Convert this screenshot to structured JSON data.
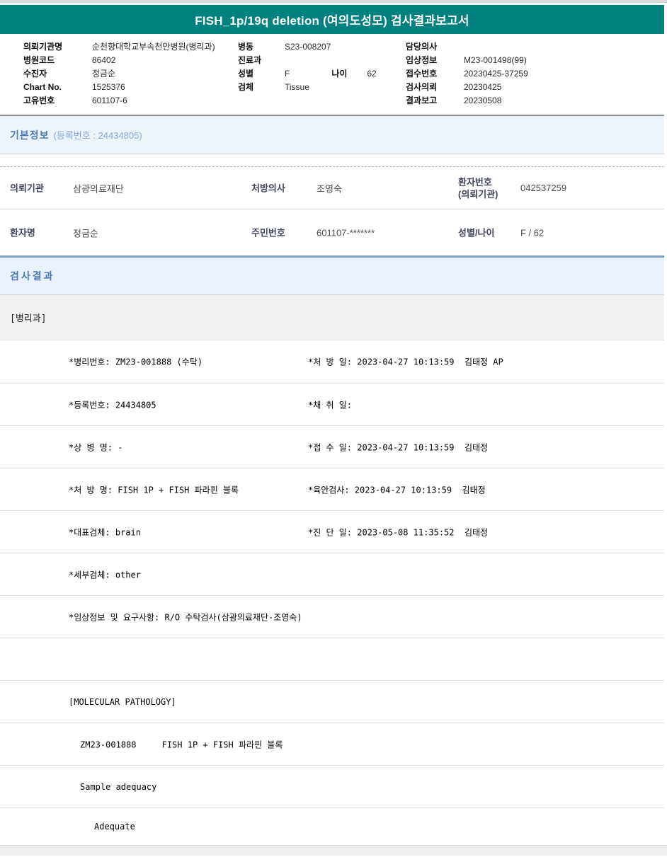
{
  "title": "FISH_1p/19q deletion (여의도성모) 검사결과보고서",
  "colors": {
    "header_teal": "#00807e",
    "section_title_blue": "#4a7ab5",
    "section_band_blue": "#edf3fa",
    "divider_steel_blue": "#7d9fc1"
  },
  "patient_header": {
    "col1": [
      {
        "label": "의뢰기관명",
        "value": "순천향대학교부속천안병원(병리과)"
      },
      {
        "label": "병원코드",
        "value": "86402"
      },
      {
        "label": "수진자",
        "value": "정금순"
      },
      {
        "label": "Chart No.",
        "value": "1525376"
      },
      {
        "label": "고유번호",
        "value": "601107-6"
      }
    ],
    "col2": [
      {
        "label": "병동",
        "value": "S23-008207"
      },
      {
        "label": "진료과",
        "value": ""
      },
      {
        "label": "성별",
        "value": "F",
        "label2": "나이",
        "value2": "62"
      },
      {
        "label": "검체",
        "value": "Tissue"
      }
    ],
    "col3": [
      {
        "label": "담당의사",
        "value": ""
      },
      {
        "label": "임상정보",
        "value": "M23-001498(99)"
      },
      {
        "label": "접수번호",
        "value": "20230425-37259"
      },
      {
        "label": "검사의뢰",
        "value": "20230425"
      },
      {
        "label": "결과보고",
        "value": "20230508"
      }
    ]
  },
  "basic_info": {
    "section_title": "기본정보",
    "section_sub": "(등록번호 : 24434805)",
    "rows": [
      [
        {
          "label_lines": [
            "의뢰기관"
          ],
          "value": "삼광의료재단"
        },
        {
          "label_lines": [
            "처방의사"
          ],
          "value": "조영숙"
        },
        {
          "label_lines": [
            "환자번호",
            "(의뢰기관)"
          ],
          "value": "042537259"
        }
      ],
      [
        {
          "label_lines": [
            "환자명"
          ],
          "value": "정금순"
        },
        {
          "label_lines": [
            "주민번호"
          ],
          "value": "601107-*******"
        },
        {
          "label_lines": [
            "성별/나이"
          ],
          "value": "F / 62"
        }
      ]
    ]
  },
  "results": {
    "section_title": "검사결과",
    "department": "[병리과]",
    "rows": [
      {
        "left": "*병리번호: ZM23-001888 (수탁)",
        "right": "*처 방 일: 2023-04-27 10:13:59  김태정 AP",
        "indent": 0
      },
      {
        "left": "*등록번호: 24434805",
        "right": "*채 취 일:",
        "indent": 0
      },
      {
        "left": "*상 병 명: -",
        "right": "*접 수 일: 2023-04-27 10:13:59  김태정",
        "indent": 0
      },
      {
        "left": "*처 방 명: FISH 1P + FISH 파라핀 블록",
        "right": "*육안검사: 2023-04-27 10:13:59  김태정",
        "indent": 0
      },
      {
        "left": "*대표검체: brain",
        "right": "*진 단 일: 2023-05-08 11:35:52  김태정",
        "indent": 0
      },
      {
        "left": "*세부검체: other",
        "right": "",
        "indent": 0
      },
      {
        "left": "*임상정보 및 요구사항: R/O 수탁검사(삼광의료재단-조영숙)",
        "right": "",
        "indent": 0
      },
      {
        "left": "",
        "right": "",
        "indent": 0
      },
      {
        "left": "[MOLECULAR PATHOLOGY]",
        "right": "",
        "indent": 0
      },
      {
        "left": "ZM23-001888     FISH 1P + FISH 파라핀 블록",
        "right": "",
        "indent": 1
      },
      {
        "left": "Sample adequacy",
        "right": "",
        "indent": 1
      },
      {
        "left": "Adequate",
        "right": "",
        "indent": 2
      }
    ]
  }
}
